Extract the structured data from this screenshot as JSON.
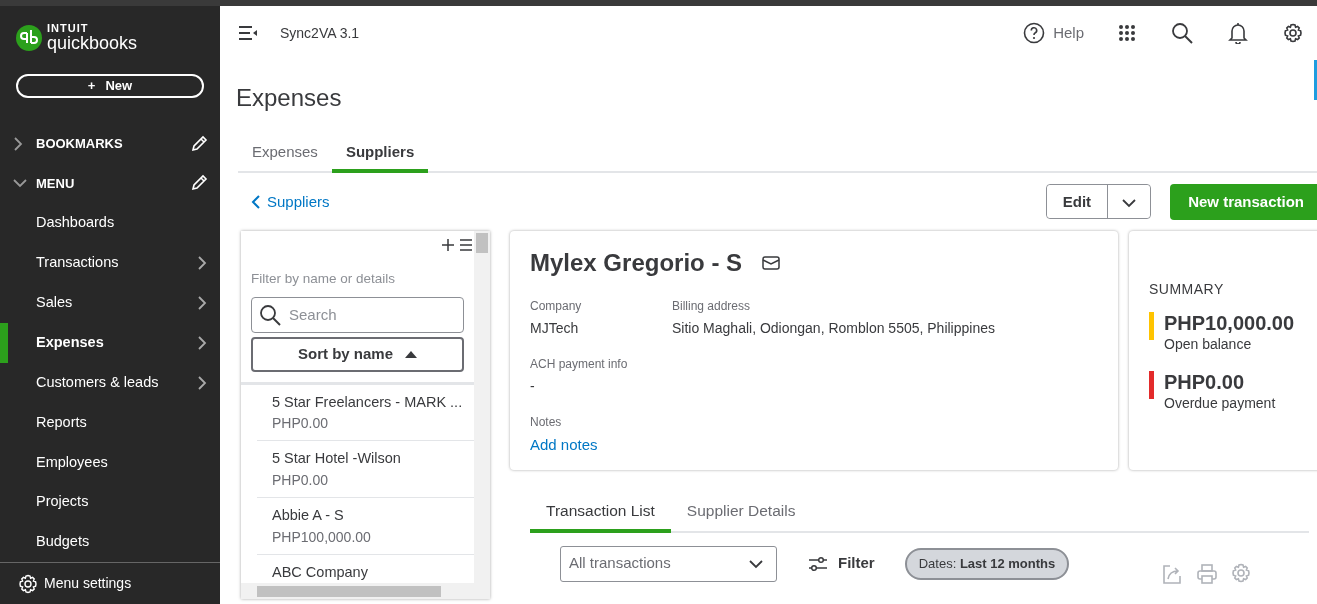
{
  "sidebar": {
    "brand_top": "INTUIT",
    "brand": "quickbooks",
    "new_icon": "+",
    "new_button": "New",
    "sections": [
      {
        "label": "BOOKMARKS",
        "expanded": false
      },
      {
        "label": "MENU",
        "expanded": true,
        "items": [
          {
            "label": "Dashboards",
            "submenu": false,
            "selected": false
          },
          {
            "label": "Transactions",
            "submenu": true,
            "selected": false
          },
          {
            "label": "Sales",
            "submenu": true,
            "selected": false
          },
          {
            "label": "Expenses",
            "submenu": true,
            "selected": true
          },
          {
            "label": "Customers & leads",
            "submenu": true,
            "selected": false
          },
          {
            "label": "Reports",
            "submenu": false,
            "selected": false
          },
          {
            "label": "Employees",
            "submenu": false,
            "selected": false
          },
          {
            "label": "Projects",
            "submenu": false,
            "selected": false
          },
          {
            "label": "Budgets",
            "submenu": false,
            "selected": false
          }
        ]
      }
    ],
    "menu_settings": "Menu settings"
  },
  "topbar": {
    "company": "Sync2VA 3.1",
    "help": "Help"
  },
  "page": {
    "title": "Expenses",
    "tabs": [
      {
        "label": "Expenses",
        "selected": false
      },
      {
        "label": "Suppliers",
        "selected": true
      }
    ],
    "back_link": "Suppliers",
    "edit_button": "Edit",
    "new_transaction": "New transaction"
  },
  "supplier_list": {
    "filter_label": "Filter by name or details",
    "search": {
      "placeholder": "Search"
    },
    "sort_button": "Sort by name",
    "suppliers": [
      {
        "name": "5 Star Freelancers - MARK ...",
        "balance": "PHP0.00"
      },
      {
        "name": "5 Star Hotel -Wilson",
        "balance": "PHP0.00"
      },
      {
        "name": "Abbie A - S",
        "balance": "PHP100,000.00"
      },
      {
        "name": "ABC Company"
      }
    ]
  },
  "supplier": {
    "name": "Mylex Gregorio - S",
    "fields": [
      {
        "label": "Company",
        "value": "MJTech",
        "kind": "text"
      },
      {
        "label": "Billing address",
        "value": "Sitio Maghali, Odiongan, Romblon 5505, Philippines",
        "kind": "text"
      },
      {
        "label": "ACH payment info",
        "value": "-",
        "kind": "text"
      },
      {
        "label": "Notes",
        "value": "Add notes",
        "kind": "link"
      }
    ]
  },
  "summary": {
    "title": "SUMMARY",
    "items": [
      {
        "amount": "PHP10,000.00",
        "label": "Open balance",
        "color": "#ffc400"
      },
      {
        "amount": "PHP0.00",
        "label": "Overdue payment",
        "color": "#e32b2b"
      }
    ]
  },
  "detail_tabs": [
    {
      "label": "Transaction List",
      "selected": true
    },
    {
      "label": "Supplier Details",
      "selected": false
    }
  ],
  "toolbar": {
    "type_dropdown": "All transactions",
    "filter_button": "Filter",
    "date_chip": "Dates: **Last 12 months**"
  }
}
